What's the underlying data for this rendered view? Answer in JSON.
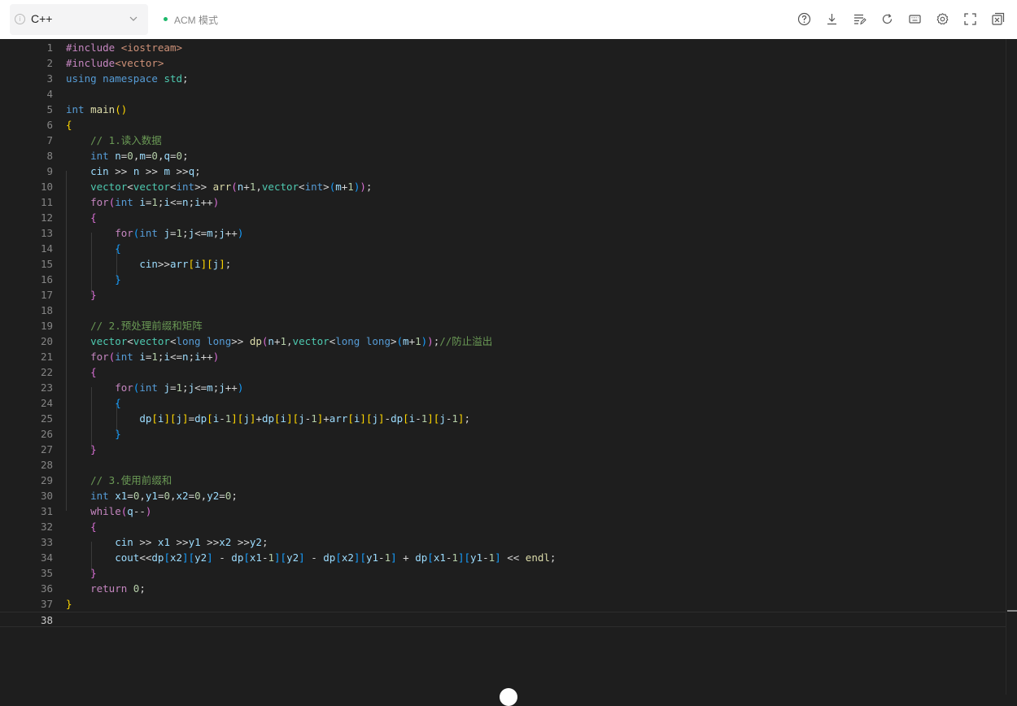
{
  "toolbar": {
    "language": "C++",
    "mode_label": "ACM 模式",
    "icons": [
      "help-icon",
      "download-icon",
      "format-icon",
      "reset-icon",
      "shortcuts-icon",
      "settings-icon",
      "fullscreen-icon",
      "close-panel-icon"
    ]
  },
  "editor": {
    "line_numbers": [
      "1",
      "2",
      "3",
      "4",
      "5",
      "6",
      "7",
      "8",
      "9",
      "10",
      "11",
      "12",
      "13",
      "14",
      "15",
      "16",
      "17",
      "18",
      "19",
      "20",
      "21",
      "22",
      "23",
      "24",
      "25",
      "26",
      "27",
      "28",
      "29",
      "30",
      "31",
      "32",
      "33",
      "34",
      "35",
      "36",
      "37",
      "38"
    ],
    "lines": [
      "#include <iostream>",
      "#include<vector>",
      "using namespace std;",
      "",
      "int main()",
      "{",
      "    // 1.读入数据",
      "    int n=0,m=0,q=0;",
      "    cin >> n >> m >>q;",
      "    vector<vector<int>> arr(n+1,vector<int>(m+1));",
      "    for(int i=1;i<=n;i++)",
      "    {",
      "        for(int j=1;j<=m;j++)",
      "        {",
      "            cin>>arr[i][j];",
      "        }",
      "    }",
      "",
      "    // 2.预处理前缀和矩阵",
      "    vector<vector<long long>> dp(n+1,vector<long long>(m+1));//防止溢出",
      "    for(int i=1;i<=n;i++)",
      "    {",
      "        for(int j=1;j<=m;j++)",
      "        {",
      "            dp[i][j]=dp[i-1][j]+dp[i][j-1]+arr[i][j]-dp[i-1][j-1];",
      "        }",
      "    }",
      "",
      "    // 3.使用前缀和",
      "    int x1=0,y1=0,x2=0,y2=0;",
      "    while(q--)",
      "    {",
      "        cin >> x1 >>y1 >>x2 >>y2;",
      "        cout<<dp[x2][y2] - dp[x1-1][y2] - dp[x2][y1-1] + dp[x1-1][y1-1] << endl;",
      "    }",
      "    return 0;",
      "}",
      ""
    ],
    "active_line": 38
  },
  "colors": {
    "keyword": "#569cd6",
    "preprocessor": "#c586c0",
    "function": "#dcdcaa",
    "string": "#ce9178",
    "number": "#b5cea8",
    "variable": "#9cdcfe",
    "comment": "#6a9955",
    "editor_background": "#1e1e1e",
    "mode_dot": "#1cb86a"
  }
}
